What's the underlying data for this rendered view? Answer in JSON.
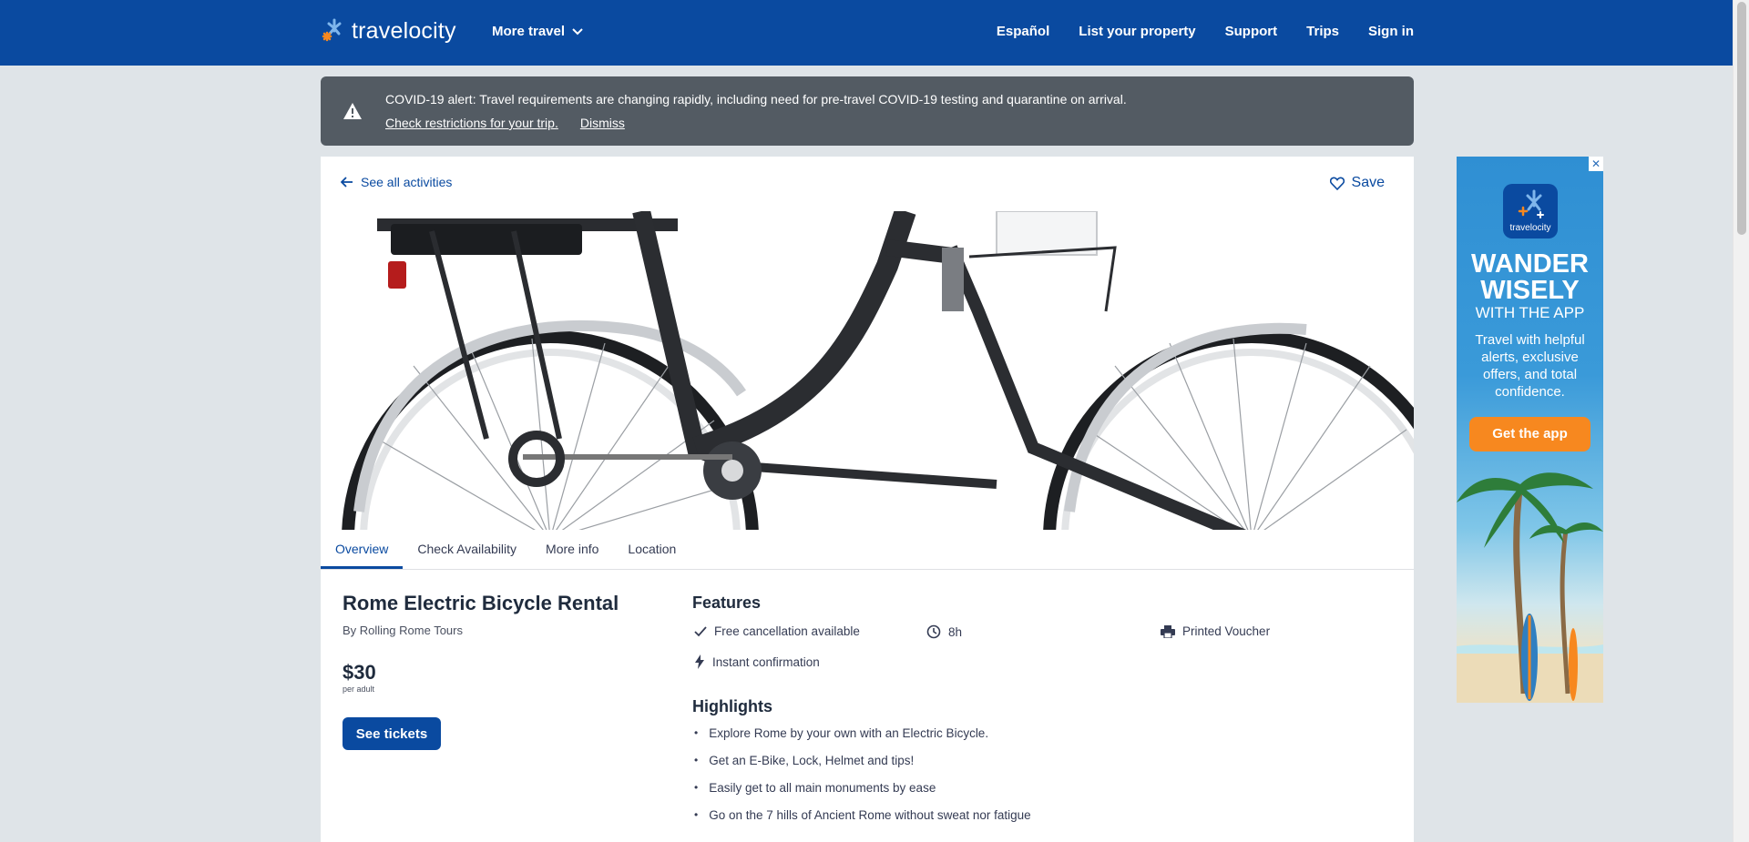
{
  "header": {
    "logo_text": "travelocity",
    "more_travel": "More travel",
    "nav": [
      "Español",
      "List your property",
      "Support",
      "Trips",
      "Sign in"
    ]
  },
  "covid": {
    "message": "COVID-19 alert: Travel requirements are changing rapidly, including need for pre-travel COVID-19 testing and quarantine on arrival.",
    "link_restrictions": "Check restrictions for your trip.",
    "link_dismiss": "Dismiss"
  },
  "card": {
    "back_link": "See all activities",
    "save": "Save",
    "tabs": [
      "Overview",
      "Check Availability",
      "More info",
      "Location"
    ],
    "title": "Rome Electric Bicycle Rental",
    "by": "By Rolling Rome Tours",
    "price": "$30",
    "price_unit": "per adult",
    "tickets_button": "See tickets",
    "features_heading": "Features",
    "features": [
      "Free cancellation available",
      "8h",
      "Printed Voucher",
      "Instant confirmation"
    ],
    "highlights_heading": "Highlights",
    "highlights": [
      "Explore Rome by your own with an Electric Bicycle.",
      "Get an E-Bike, Lock, Helmet and tips!",
      "Easily get to all main monuments by ease",
      "Go on the 7 hills of Ancient Rome without sweat nor fatigue"
    ]
  },
  "ad": {
    "logo_text": "travelocity",
    "headline": "WANDER WISELY",
    "subheadline": "WITH THE APP",
    "body": "Travel with helpful alerts, exclusive offers, and total confidence.",
    "button": "Get the app",
    "close": "✕"
  },
  "colors": {
    "brand_blue": "#0a4aa0",
    "banner_gray": "#535b63",
    "ad_orange": "#f7881f"
  }
}
